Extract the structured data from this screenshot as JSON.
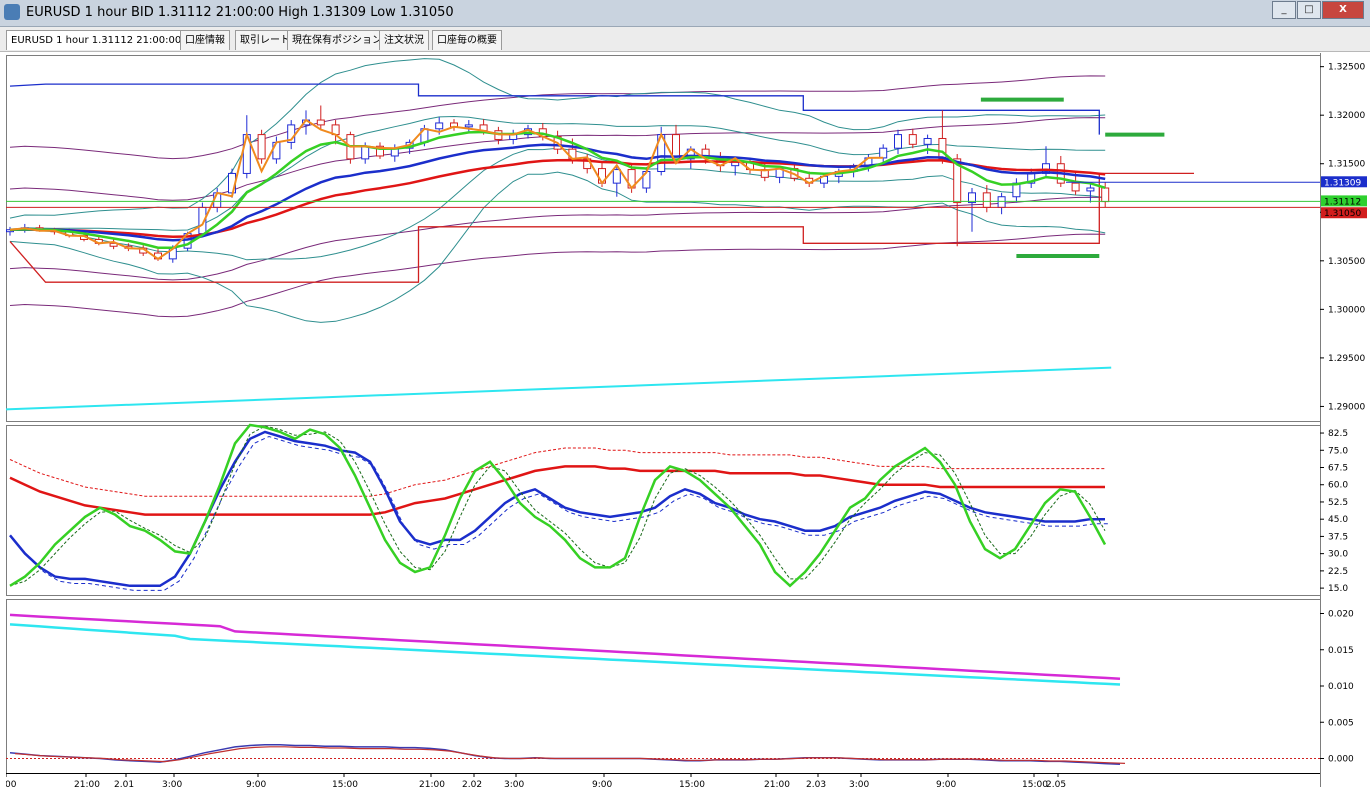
{
  "window": {
    "title": "EURUSD 1 hour BID 1.31112 21:00:00 High 1.31309 Low 1.31050",
    "buttons": [
      "_",
      "□",
      "X"
    ]
  },
  "tabs": [
    {
      "label": "EURUSD 1 hour 1.31112 21:00:00",
      "active": true
    },
    {
      "label": "口座情報",
      "active": false
    },
    {
      "label": "取引レート",
      "active": false
    },
    {
      "label": "現在保有ポジション",
      "active": false
    },
    {
      "label": "注文状況",
      "active": false
    },
    {
      "label": "口座毎の概要",
      "active": false
    }
  ],
  "colors": {
    "up_candle": "#1f2bd6",
    "down_candle": "#d02020",
    "ma_blue": "#1b2ecb",
    "ma_red": "#e01515",
    "ma_green": "#36d024",
    "ma_orange": "#f08a1e",
    "cyan": "#2ee6f0",
    "magenta": "#d62ad6",
    "purple_band": "#7a2a7a",
    "teal_band": "#2f8f8f",
    "level_green": "#2daa3c"
  },
  "price_axis": {
    "ticks": [
      "1.32500",
      "1.32000",
      "1.31500",
      "1.31000",
      "1.30500",
      "1.30000",
      "1.29500",
      "1.29000"
    ],
    "label_high": "1.31309",
    "label_current": "1.31112",
    "label_low": "1.31050"
  },
  "stoch_axis": {
    "ticks": [
      "82.5",
      "75.0",
      "67.5",
      "60.0",
      "52.5",
      "45.0",
      "37.5",
      "30.0",
      "22.5",
      "15.0"
    ]
  },
  "lower_axis": {
    "ticks": [
      "0.020",
      "0.015",
      "0.010",
      "0.005",
      "0.000"
    ]
  },
  "time_axis": {
    "labels": [
      ":00",
      "21:00",
      "2.01",
      "3:00",
      "9:00",
      "15:00",
      "21:00",
      "2.02",
      "3:00",
      "9:00",
      "15:00",
      "21:00",
      "2.03",
      "3:00",
      "9:00",
      "15:00",
      "2.05"
    ]
  },
  "chart_data": {
    "type": "line",
    "candles_ohlc": [
      [
        1.308,
        1.3085,
        1.3076,
        1.3082
      ],
      [
        1.3082,
        1.3088,
        1.3079,
        1.3084
      ],
      [
        1.3084,
        1.3087,
        1.308,
        1.3081
      ],
      [
        1.3081,
        1.3084,
        1.3077,
        1.308
      ],
      [
        1.308,
        1.3083,
        1.3074,
        1.3076
      ],
      [
        1.3076,
        1.3079,
        1.307,
        1.3072
      ],
      [
        1.3072,
        1.3075,
        1.3066,
        1.3068
      ],
      [
        1.3068,
        1.3072,
        1.3062,
        1.3065
      ],
      [
        1.3065,
        1.3068,
        1.306,
        1.3063
      ],
      [
        1.3063,
        1.3066,
        1.3055,
        1.3058
      ],
      [
        1.3058,
        1.3062,
        1.305,
        1.3052
      ],
      [
        1.3052,
        1.3066,
        1.3048,
        1.3063
      ],
      [
        1.3063,
        1.308,
        1.306,
        1.3078
      ],
      [
        1.3078,
        1.311,
        1.3074,
        1.3105
      ],
      [
        1.3105,
        1.3125,
        1.31,
        1.312
      ],
      [
        1.312,
        1.3145,
        1.3115,
        1.314
      ],
      [
        1.314,
        1.32,
        1.3135,
        1.318
      ],
      [
        1.318,
        1.3185,
        1.315,
        1.3155
      ],
      [
        1.3155,
        1.3178,
        1.315,
        1.3172
      ],
      [
        1.3172,
        1.3195,
        1.3165,
        1.319
      ],
      [
        1.319,
        1.3205,
        1.318,
        1.3195
      ],
      [
        1.3195,
        1.321,
        1.3185,
        1.319
      ],
      [
        1.319,
        1.3195,
        1.317,
        1.318
      ],
      [
        1.318,
        1.3183,
        1.315,
        1.3155
      ],
      [
        1.3155,
        1.3172,
        1.315,
        1.3168
      ],
      [
        1.3168,
        1.3172,
        1.3155,
        1.3158
      ],
      [
        1.3158,
        1.317,
        1.3152,
        1.3166
      ],
      [
        1.3166,
        1.3175,
        1.316,
        1.3172
      ],
      [
        1.3172,
        1.319,
        1.3168,
        1.3186
      ],
      [
        1.3186,
        1.3198,
        1.318,
        1.3192
      ],
      [
        1.3192,
        1.3196,
        1.3184,
        1.3188
      ],
      [
        1.3188,
        1.3195,
        1.3182,
        1.319
      ],
      [
        1.319,
        1.3196,
        1.318,
        1.3184
      ],
      [
        1.3184,
        1.3188,
        1.317,
        1.3175
      ],
      [
        1.3175,
        1.3185,
        1.317,
        1.318
      ],
      [
        1.318,
        1.319,
        1.3176,
        1.3186
      ],
      [
        1.3186,
        1.3192,
        1.3174,
        1.3178
      ],
      [
        1.3178,
        1.3184,
        1.316,
        1.3165
      ],
      [
        1.3165,
        1.3176,
        1.315,
        1.3155
      ],
      [
        1.3155,
        1.316,
        1.314,
        1.3145
      ],
      [
        1.3145,
        1.3152,
        1.3126,
        1.313
      ],
      [
        1.313,
        1.3148,
        1.3116,
        1.3144
      ],
      [
        1.3144,
        1.315,
        1.312,
        1.3125
      ],
      [
        1.3125,
        1.3146,
        1.312,
        1.3142
      ],
      [
        1.3142,
        1.3188,
        1.3138,
        1.318
      ],
      [
        1.318,
        1.319,
        1.315,
        1.3155
      ],
      [
        1.3155,
        1.3168,
        1.3145,
        1.3165
      ],
      [
        1.3165,
        1.317,
        1.315,
        1.3156
      ],
      [
        1.3156,
        1.3162,
        1.3142,
        1.3148
      ],
      [
        1.3148,
        1.3156,
        1.3138,
        1.3152
      ],
      [
        1.3152,
        1.3156,
        1.314,
        1.3144
      ],
      [
        1.3144,
        1.315,
        1.3132,
        1.3136
      ],
      [
        1.3136,
        1.3148,
        1.313,
        1.3145
      ],
      [
        1.3145,
        1.315,
        1.3132,
        1.3135
      ],
      [
        1.3135,
        1.3142,
        1.3126,
        1.313
      ],
      [
        1.313,
        1.314,
        1.3125,
        1.3137
      ],
      [
        1.3137,
        1.3145,
        1.313,
        1.3142
      ],
      [
        1.3142,
        1.315,
        1.3136,
        1.3148
      ],
      [
        1.3148,
        1.316,
        1.3142,
        1.3156
      ],
      [
        1.3156,
        1.317,
        1.315,
        1.3166
      ],
      [
        1.3166,
        1.3185,
        1.316,
        1.318
      ],
      [
        1.318,
        1.3186,
        1.3166,
        1.317
      ],
      [
        1.317,
        1.318,
        1.316,
        1.3176
      ],
      [
        1.3176,
        1.3205,
        1.315,
        1.3155
      ],
      [
        1.3155,
        1.316,
        1.3065,
        1.311
      ],
      [
        1.311,
        1.3125,
        1.308,
        1.312
      ],
      [
        1.312,
        1.3128,
        1.31,
        1.3105
      ],
      [
        1.3105,
        1.312,
        1.3098,
        1.3116
      ],
      [
        1.3116,
        1.3135,
        1.311,
        1.313
      ],
      [
        1.313,
        1.3145,
        1.3125,
        1.314
      ],
      [
        1.314,
        1.3168,
        1.3135,
        1.315
      ],
      [
        1.315,
        1.3158,
        1.3126,
        1.313
      ],
      [
        1.313,
        1.3142,
        1.3118,
        1.3122
      ],
      [
        1.3122,
        1.313,
        1.311,
        1.3125
      ],
      [
        1.3125,
        1.3131,
        1.3105,
        1.3111
      ]
    ],
    "price_ylim": [
      1.2885,
      1.3262
    ],
    "stoch_ylim": [
      12,
      86
    ],
    "lower_ylim": [
      -0.002,
      0.022
    ],
    "pivot_lines": {
      "blue_high": [
        [
          0,
          1.323
        ],
        [
          6,
          1.3232
        ],
        [
          69,
          1.3232
        ],
        [
          69,
          1.322
        ],
        [
          134,
          1.322
        ],
        [
          134,
          1.3205
        ],
        [
          184,
          1.3205
        ],
        [
          184,
          1.318
        ]
      ],
      "red_low": [
        [
          0,
          1.307
        ],
        [
          6,
          1.3028
        ],
        [
          69,
          1.3028
        ],
        [
          69,
          1.3085
        ],
        [
          134,
          1.3085
        ],
        [
          134,
          1.3068
        ],
        [
          184,
          1.3068
        ],
        [
          184,
          1.314
        ],
        [
          200,
          1.314
        ]
      ]
    },
    "levels": {
      "green_upper": [
        [
          164,
          1.3216
        ],
        [
          178,
          1.3216
        ]
      ],
      "green_mid": [
        [
          185,
          1.318
        ],
        [
          195,
          1.318
        ]
      ],
      "green_low": [
        [
          170,
          1.3055
        ],
        [
          184,
          1.3055
        ]
      ]
    }
  }
}
